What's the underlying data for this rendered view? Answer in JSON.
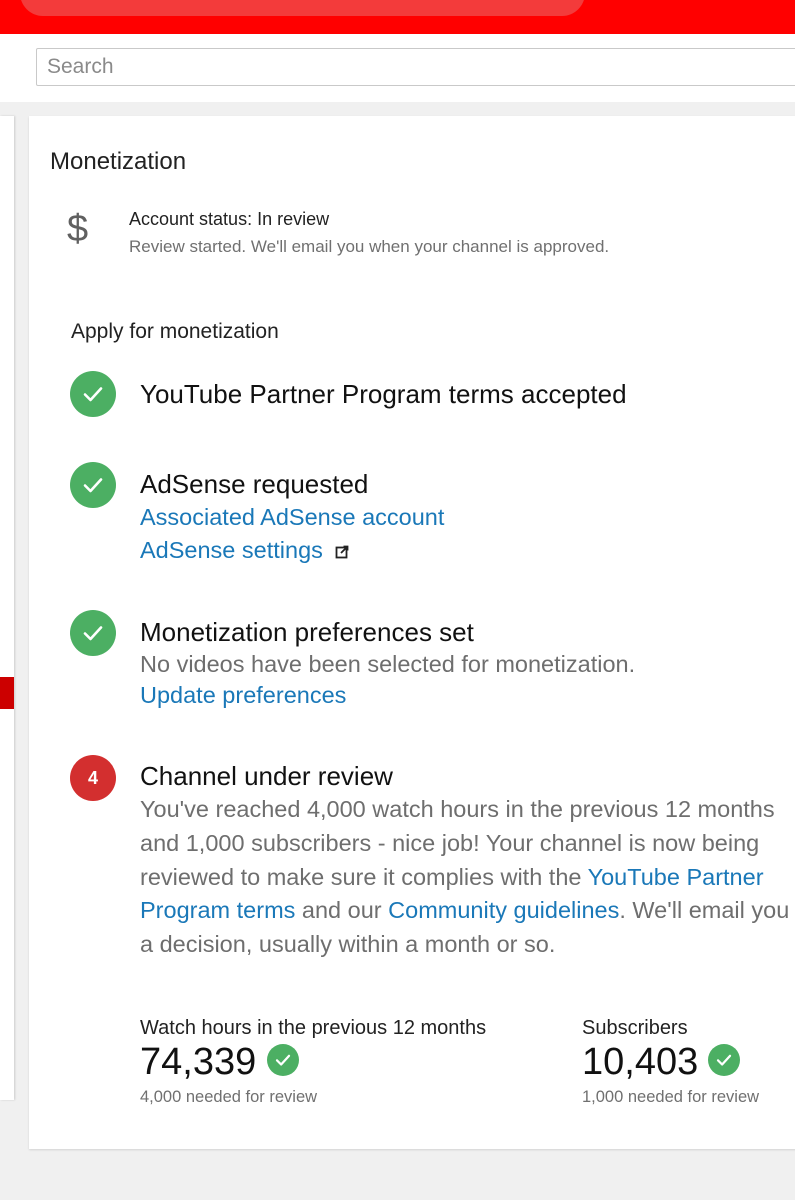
{
  "search": {
    "placeholder": "Search"
  },
  "monetization": {
    "title": "Monetization",
    "account_status": {
      "icon": "dollar-icon",
      "title": "Account status: In review",
      "subtitle": "Review started. We'll email you when your channel is approved."
    },
    "apply_heading": "Apply for monetization",
    "steps": [
      {
        "icon": "check-icon",
        "title": "YouTube Partner Program terms accepted"
      },
      {
        "icon": "check-icon",
        "title": "AdSense requested",
        "link1": "Associated AdSense account",
        "link2": "AdSense settings"
      },
      {
        "icon": "check-icon",
        "title": "Monetization preferences set",
        "text": "No videos have been selected for monetization.",
        "link": "Update preferences"
      },
      {
        "badge": "4",
        "title": "Channel under review",
        "text_before": "You've reached 4,000 watch hours in the previous 12 months and 1,000 subscribers - nice job! Your channel is now being reviewed to make sure it complies with the ",
        "link_terms": "YouTube Partner Program terms",
        "text_mid": " and our ",
        "link_guidelines": "Community guidelines",
        "text_after": ". We'll email you a decision, usually within a month or so."
      }
    ],
    "stats": {
      "watch_hours": {
        "label": "Watch hours in the previous 12 months",
        "value": "74,339",
        "sub": "4,000 needed for review"
      },
      "subscribers": {
        "label": "Subscribers",
        "value": "10,403",
        "sub": "1,000 needed for review"
      }
    }
  },
  "colors": {
    "brand_red": "#ff0000",
    "success_green": "#4caf63",
    "link_blue": "#1a78b8",
    "badge_red": "#d32f2f"
  }
}
